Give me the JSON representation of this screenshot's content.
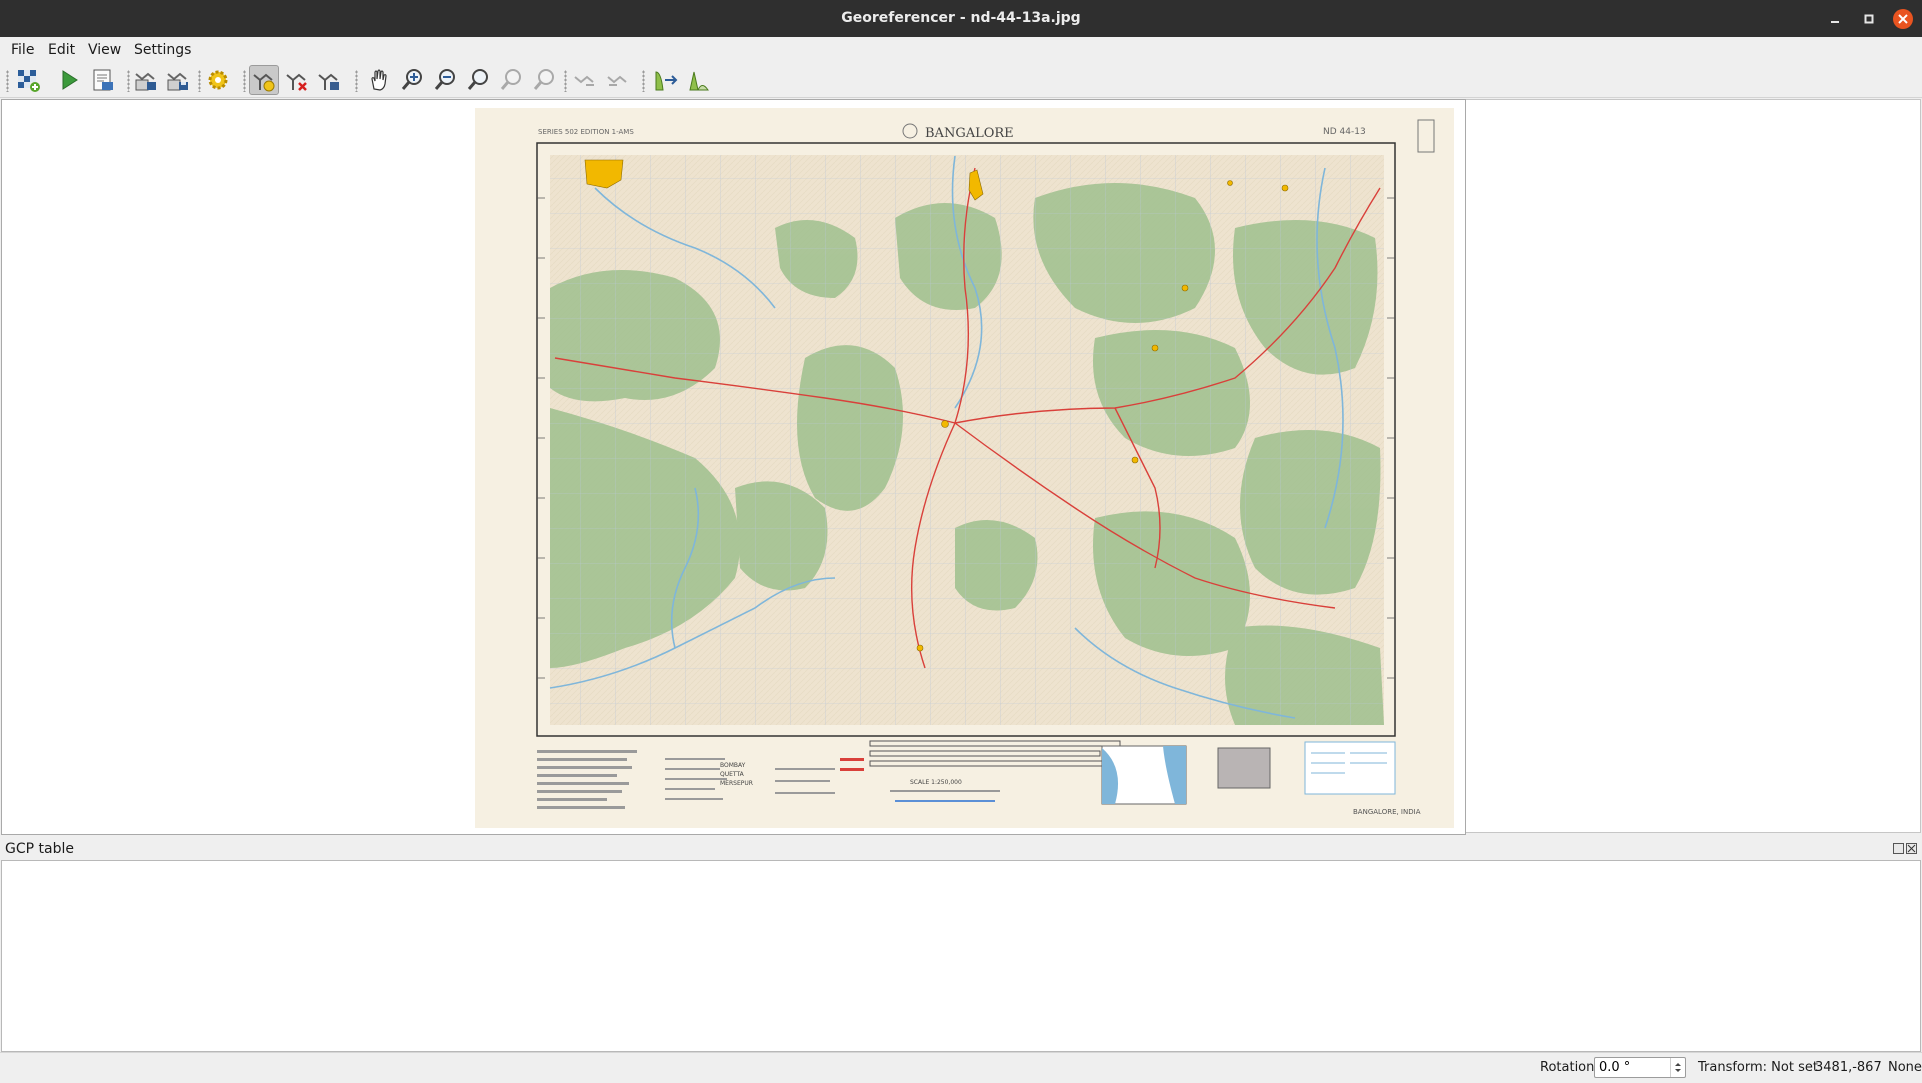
{
  "window": {
    "title": "Georeferencer - nd-44-13a.jpg"
  },
  "menu": {
    "file": "File",
    "edit": "Edit",
    "view": "View",
    "settings": "Settings"
  },
  "toolbar": {
    "icons": [
      "open-raster-icon",
      "start-georeferencing-icon",
      "generate-gdal-script-icon",
      "load-gcp-points-icon",
      "save-gcp-points-icon",
      "transformation-settings-icon",
      "add-point-icon",
      "delete-point-icon",
      "move-gcp-point-icon",
      "pan-icon",
      "zoom-in-icon",
      "zoom-out-icon",
      "zoom-to-layer-icon",
      "zoom-last-icon",
      "zoom-next-icon",
      "link-georeferencer-to-qgis-icon",
      "link-qgis-to-georeferencer-icon",
      "full-histogram-stretch-icon",
      "local-histogram-stretch-icon"
    ],
    "active": "add-point-icon"
  },
  "map": {
    "title": "BANGALORE",
    "series_left": "SERIES 502   EDITION 1-AMS",
    "sheet_code": "ND 44-13",
    "sheet_right": "BANGALORE, INDIA",
    "scale_text": "SCALE 1:250,000",
    "colors": {
      "paper": "#f6f0e2",
      "forest": "#9fc08e",
      "water": "#7fb6da",
      "roads": "#d9403a",
      "towns": "#f2b800"
    }
  },
  "gcp_panel": {
    "title": "GCP table"
  },
  "status": {
    "rotation_label": "Rotation",
    "rotation_value": "0.0 °",
    "transform": "Transform: Not set",
    "coords": "3481,-867",
    "crs": "None"
  }
}
